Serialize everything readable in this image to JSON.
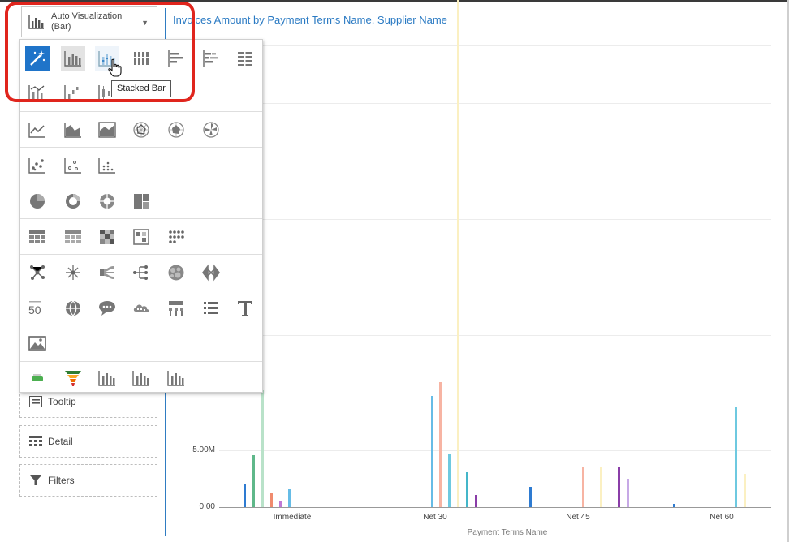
{
  "viz_select": {
    "label": "Auto Visualization (Bar)"
  },
  "chart_title": "Invoices Amount by Payment Terms Name, Supplier Name",
  "tooltip": "Stacked Bar",
  "zones": [
    {
      "label": "Tooltip",
      "icon": "tooltip-icon"
    },
    {
      "label": "Detail",
      "icon": "detail-icon"
    },
    {
      "label": "Filters",
      "icon": "filter-icon"
    }
  ],
  "chart_data": {
    "type": "bar",
    "title": "Invoices Amount by Payment Terms Name, Supplier Name",
    "xlabel": "Payment Terms Name",
    "ylabel": "",
    "categories": [
      "Immediate",
      "Net 30",
      "Net 45",
      "Net 60"
    ],
    "y_ticks": [
      "0.00",
      "5.00M"
    ],
    "ylim": [
      0,
      75000000
    ],
    "grid": true,
    "series": [
      {
        "color": "#2e7bd1",
        "values": [
          2100000,
          0,
          1800000,
          300000
        ]
      },
      {
        "color": "#5fb88a",
        "values": [
          4600000,
          0,
          0,
          0
        ]
      },
      {
        "color": "#b9e2c9",
        "values": [
          10300000,
          0,
          0,
          0
        ]
      },
      {
        "color": "#f08b6e",
        "values": [
          1300000,
          0,
          0,
          0
        ]
      },
      {
        "color": "#c079d6",
        "values": [
          500000,
          0,
          0,
          0
        ]
      },
      {
        "color": "#66bce6",
        "values": [
          1600000,
          9800000,
          0,
          0
        ]
      },
      {
        "color": "#f7b4a3",
        "values": [
          0,
          11000000,
          3600000,
          0
        ]
      },
      {
        "color": "#6ec9e0",
        "values": [
          0,
          4700000,
          0,
          8800000
        ]
      },
      {
        "color": "#fbf0c2",
        "values": [
          0,
          71000000,
          3500000,
          2900000
        ]
      },
      {
        "color": "#44b6c9",
        "values": [
          0,
          3100000,
          0,
          0
        ]
      },
      {
        "color": "#8a3da8",
        "values": [
          0,
          1100000,
          3600000,
          0
        ]
      },
      {
        "color": "#c7a9e6",
        "values": [
          0,
          0,
          2500000,
          0
        ]
      }
    ]
  }
}
